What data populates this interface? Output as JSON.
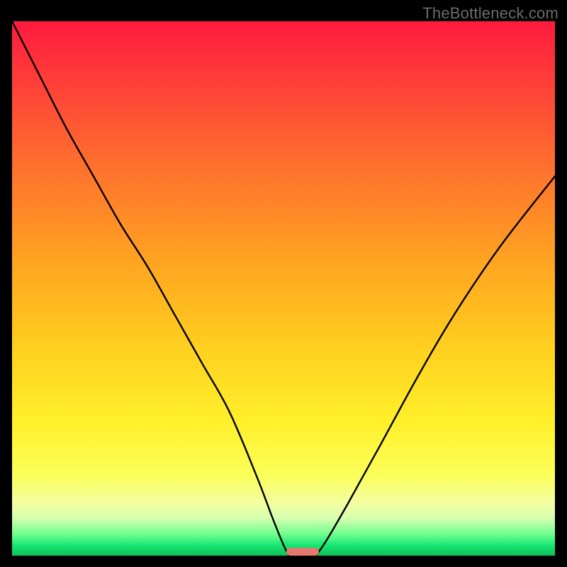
{
  "attribution": "TheBottleneck.com",
  "colors": {
    "frame_background": "#000000",
    "curve_stroke": "#000000",
    "marker_fill": "#e4796d",
    "attribution_text": "#6b6b6b",
    "gradient_top": "#ff1a3d",
    "gradient_bottom": "#0fbf59"
  },
  "chart_data": {
    "type": "line",
    "title": "",
    "xlabel": "",
    "ylabel": "",
    "xlim": [
      0,
      100
    ],
    "ylim": [
      0,
      100
    ],
    "grid": false,
    "legend": false,
    "series": [
      {
        "name": "left-branch",
        "x": [
          0,
          5,
          10,
          15,
          20,
          25,
          30,
          35,
          40,
          45,
          48,
          50,
          51
        ],
        "y": [
          100,
          90,
          80,
          71,
          62,
          54,
          45,
          36,
          27,
          15,
          7,
          2,
          0
        ]
      },
      {
        "name": "right-branch",
        "x": [
          56,
          58,
          62,
          68,
          75,
          82,
          90,
          100
        ],
        "y": [
          0,
          3,
          10,
          21,
          34,
          46,
          58,
          71
        ]
      }
    ],
    "marker": {
      "x_center": 53.5,
      "x_half_width": 3,
      "y": 0,
      "shape": "pill"
    },
    "note": "y-values are relative bottleneck percentage (0=green baseline, 100=top of gradient); x is a normalized balance axis. Values estimated from pixel positions."
  }
}
